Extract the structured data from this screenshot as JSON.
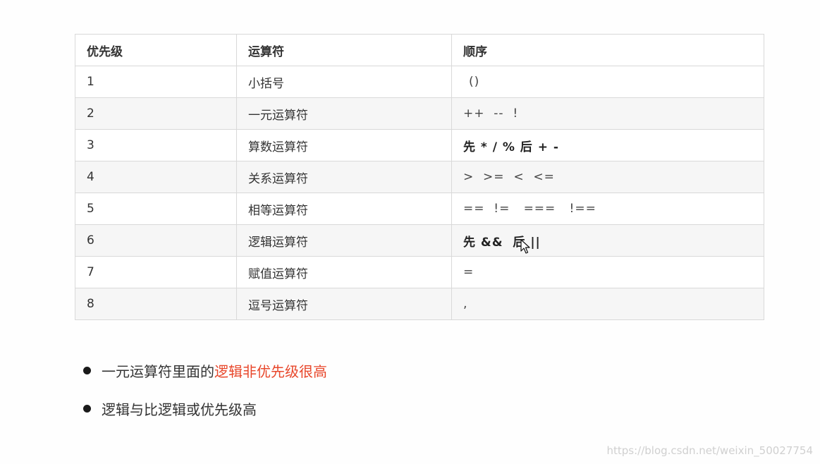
{
  "table": {
    "headers": [
      "优先级",
      "运算符",
      "顺序"
    ],
    "rows": [
      {
        "level": "1",
        "operator": "小括号",
        "order": "()"
      },
      {
        "level": "2",
        "operator": "一元运算符",
        "order": "++  --  !"
      },
      {
        "level": "3",
        "operator": "算数运算符",
        "order": "先 * / % 后 + -"
      },
      {
        "level": "4",
        "operator": "关系运算符",
        "order": ">  >=  <  <="
      },
      {
        "level": "5",
        "operator": "相等运算符",
        "order": "==  !=   ===   !=="
      },
      {
        "level": "6",
        "operator": "逻辑运算符",
        "order": "先 &&  后 ||"
      },
      {
        "level": "7",
        "operator": "赋值运算符",
        "order": "="
      },
      {
        "level": "8",
        "operator": "逗号运算符",
        "order": ","
      }
    ]
  },
  "notes": {
    "note1_prefix": "一元运算符里面的",
    "note1_highlight": "逻辑非优先级很高",
    "note2": "逻辑与比逻辑或优先级高"
  },
  "colors": {
    "highlight": "#e8472b"
  },
  "icons": {
    "cursor": "mouse-pointer-icon",
    "bullet": "bullet-dot-icon"
  },
  "watermark": "https://blog.csdn.net/weixin_50027754"
}
